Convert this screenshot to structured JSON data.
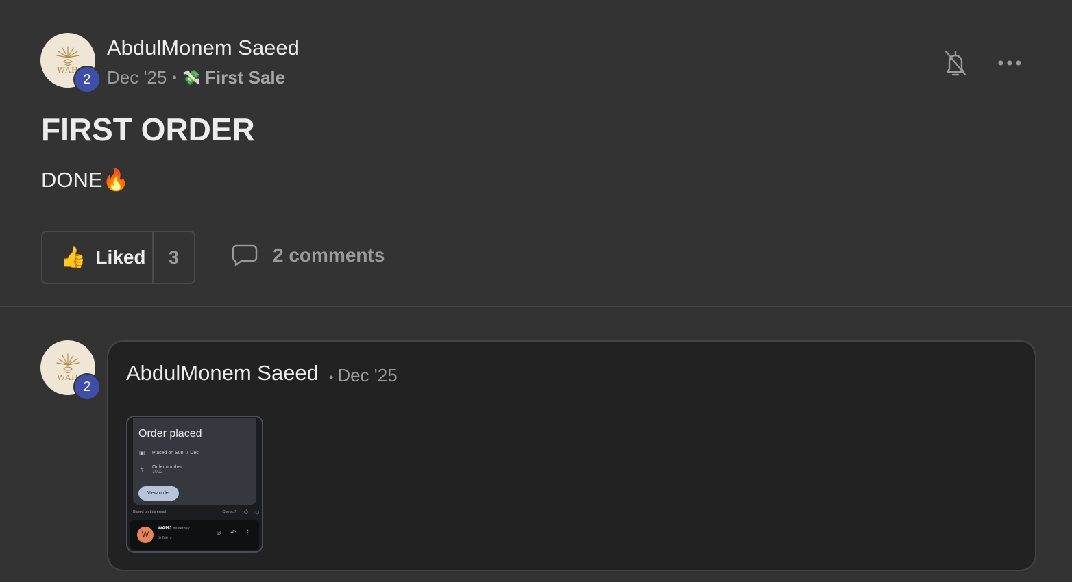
{
  "post": {
    "author": {
      "name": "AbdulMonem Saeed",
      "level": "2",
      "avatar_logo": "WAH"
    },
    "date": "Dec '25",
    "category": {
      "label": "First Sale",
      "icon": "💸"
    },
    "title": "FIRST ORDER",
    "body": "DONE🔥",
    "like": {
      "label": "Liked",
      "count": "3",
      "icon": "👍"
    },
    "comments": {
      "label": "2 comments"
    }
  },
  "comment": {
    "author": {
      "name": "AbdulMonem Saeed",
      "level": "2",
      "avatar_logo": "WAH"
    },
    "date": "Dec '25",
    "attachment": {
      "title": "Order placed",
      "placed_on": "Placed on Sun, 7 Dec",
      "order_number_label": "Order number",
      "order_number": "1002",
      "view_order": "View order",
      "based_on": "Based on this email",
      "correct": "Correct?",
      "sender_initial": "W",
      "sender": "WAHJ",
      "when": "Yesterday",
      "to": "to me ⌄"
    }
  },
  "colors": {
    "background": "#333333",
    "card": "#222222",
    "badge": "#3f4ea8",
    "text": "#ececec",
    "muted": "#9a9a9a"
  },
  "icons": {
    "bell_off": "bell-off-icon",
    "more": "more-horizontal-icon",
    "comment": "comment-bubble-icon",
    "like": "thumbs-up-icon"
  }
}
